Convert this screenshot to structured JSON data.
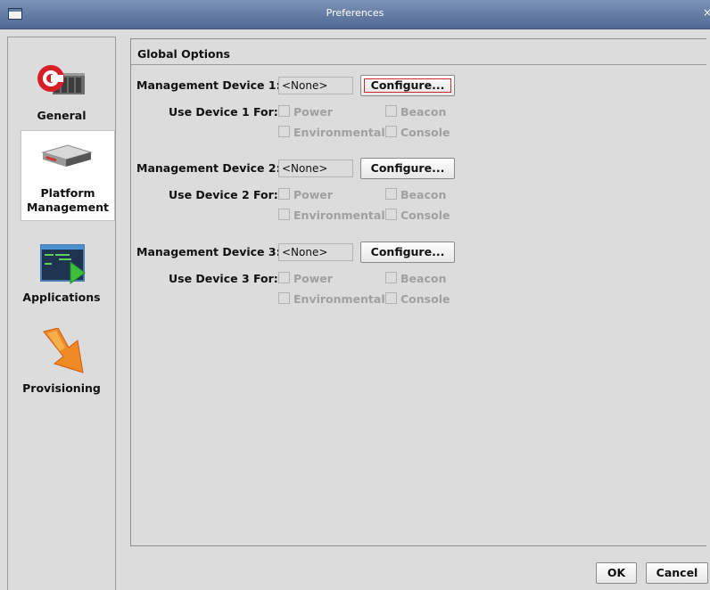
{
  "window": {
    "title": "Preferences",
    "close_glyph": "×"
  },
  "sidebar": {
    "items": [
      {
        "label": "General",
        "icon": "general-icon",
        "selected": false
      },
      {
        "label": "Platform Management",
        "icon": "server-icon",
        "selected": true
      },
      {
        "label": "Applications",
        "icon": "terminal-icon",
        "selected": false
      },
      {
        "label": "Provisioning",
        "icon": "provisioning-arrow-icon",
        "selected": false
      }
    ]
  },
  "panel": {
    "title": "Global Options",
    "devices": [
      {
        "label": "Management Device 1:",
        "value": "<None>",
        "configure_label": "Configure...",
        "use_for_label": "Use Device 1 For:",
        "options": [
          "Power",
          "Beacon",
          "Environmental",
          "Console"
        ]
      },
      {
        "label": "Management Device 2:",
        "value": "<None>",
        "configure_label": "Configure...",
        "use_for_label": "Use Device 2 For:",
        "options": [
          "Power",
          "Beacon",
          "Environmental",
          "Console"
        ]
      },
      {
        "label": "Management Device 3:",
        "value": "<None>",
        "configure_label": "Configure...",
        "use_for_label": "Use Device 3 For:",
        "options": [
          "Power",
          "Beacon",
          "Environmental",
          "Console"
        ]
      }
    ]
  },
  "footer": {
    "ok_label": "OK",
    "cancel_label": "Cancel"
  }
}
